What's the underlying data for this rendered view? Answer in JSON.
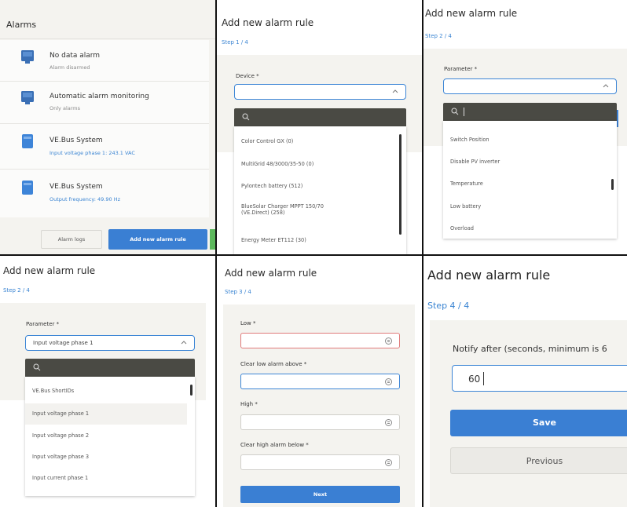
{
  "panel1": {
    "title": "Alarms",
    "alarms": [
      {
        "title": "No data alarm",
        "subtitle": "Alarm disarmed"
      },
      {
        "title": "Automatic alarm monitoring",
        "subtitle": "Only alarms"
      },
      {
        "title": "VE.Bus System",
        "subtitle": "Input voltage phase 1: 243.1 VAC"
      },
      {
        "title": "VE.Bus System",
        "subtitle": "Output frequency: 49.90 Hz"
      }
    ],
    "alarm_logs_label": "Alarm logs",
    "add_rule_label": "Add new alarm rule",
    "colors": {
      "accent": "#3a7fd3",
      "green_peek": "#5cb85c"
    }
  },
  "panel2": {
    "title": "Add new alarm rule",
    "step": "Step 1 / 4",
    "field_label": "Device *",
    "value": "",
    "options": [
      "Color Control GX (0)",
      "MultiGrid 48/3000/35-50 (0)",
      "Pylontech battery (512)",
      "BlueSolar Charger MPPT 150/70",
      "(VE.Direct) (258)",
      "Energy Meter ET112 (30)"
    ]
  },
  "panel3": {
    "title": "Add new alarm rule",
    "step": "Step 2 / 4",
    "field_label": "Parameter *",
    "value": "",
    "options": [
      "Switch Position",
      "Disable PV inverter",
      "Temperature",
      "Low battery",
      "Overload"
    ]
  },
  "panel4": {
    "title": "Add new alarm rule",
    "step": "Step 2 / 4",
    "field_label": "Parameter *",
    "value": "Input voltage phase 1",
    "options": [
      "VE.Bus ShortIDs",
      "Input voltage phase 1",
      "Input voltage phase 2",
      "Input voltage phase 3",
      "Input current phase 1"
    ]
  },
  "panel5": {
    "title": "Add new alarm rule",
    "step": "Step 3 / 4",
    "fields": [
      {
        "label": "Low *"
      },
      {
        "label": "Clear low alarm above *"
      },
      {
        "label": "High *"
      },
      {
        "label": "Clear high alarm below *"
      }
    ],
    "next_label": "Next"
  },
  "panel6": {
    "title": "Add new alarm rule",
    "step": "Step 4 / 4",
    "notify_label": "Notify after (seconds, minimum is 6",
    "notify_value": "60",
    "save_label": "Save",
    "previous_label": "Previous"
  },
  "icons": {
    "search": "search-icon",
    "chevron": "chevron-up-icon",
    "device": "device-icon",
    "spinner": "number-spinner-icon"
  }
}
